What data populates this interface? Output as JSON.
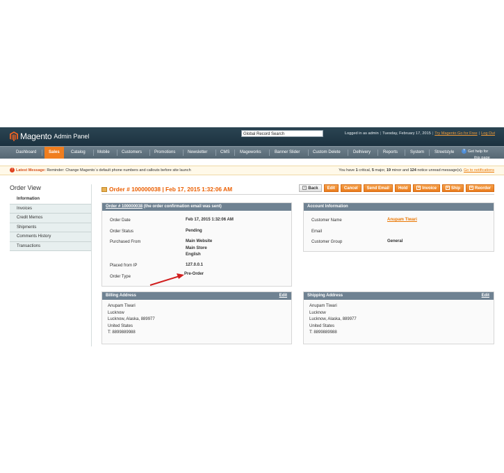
{
  "header": {
    "logo_text": "Magento",
    "logo_sub": "Admin Panel",
    "search_value": "Global Record Search",
    "logged_in": "Logged in as admin",
    "date": "Tuesday, February 17, 2015",
    "try_go": "Try Magento Go for Free",
    "logout": "Log Out"
  },
  "nav": {
    "items": [
      "Dashboard",
      "Sales",
      "Catalog",
      "Mobile",
      "Customers",
      "Promotions",
      "Newsletter",
      "CMS",
      "Mageworks",
      "Banner Slider",
      "Custom Delete",
      "Delhivery",
      "Reports",
      "System",
      "Streetstyle"
    ],
    "active": "Sales",
    "help": "Get help for this page",
    "help_line1": "Get help for",
    "help_line2": "this page"
  },
  "message": {
    "label": "Latest Message:",
    "text": "Reminder: Change Magento`s default phone numbers and callouts before site launch",
    "right_prefix": "You have",
    "critical_count": "1",
    "critical_word": "critical,",
    "major_count": "5",
    "major_word": "major,",
    "minor_count": "19",
    "minor_word": "minor and",
    "notice_count": "124",
    "notice_word": "notice unread message(s).",
    "go_link": "Go to notifications"
  },
  "sidebar": {
    "title": "Order View",
    "items": [
      "Information",
      "Invoices",
      "Credit Memos",
      "Shipments",
      "Comments History",
      "Transactions"
    ]
  },
  "page": {
    "title": "Order # 100000038 | Feb 17, 2015 1:32:06 AM",
    "buttons": [
      "Back",
      "Edit",
      "Cancel",
      "Send Email",
      "Hold",
      "Invoice",
      "Ship",
      "Reorder"
    ]
  },
  "order_box": {
    "header_link": "Order # 100000038",
    "header_note": "(the order confirmation email was sent)",
    "labels": [
      "Order Date",
      "Order Status",
      "Purchased From",
      "Placed from IP",
      "Order Type"
    ],
    "order_date": "Feb 17, 2015 1:32:06 AM",
    "status": "Pending",
    "purchased_from": [
      "Main Website",
      "Main Store",
      "English"
    ],
    "ip": "127.0.0.1",
    "order_type": "Pre-Order"
  },
  "account_box": {
    "header": "Account Information",
    "labels": [
      "Customer Name",
      "Email",
      "Customer Group"
    ],
    "customer_name": "Anupam Tiwari",
    "group": "General"
  },
  "billing": {
    "header": "Billing Address",
    "edit": "Edit",
    "lines": [
      "Anupam Tiwari",
      "Lucknow",
      "Lucknow, Alaska, 889977",
      "United States",
      "T: 8899889988"
    ]
  },
  "shipping": {
    "header": "Shipping Address",
    "edit": "Edit",
    "lines": [
      "Anupam Tiwari",
      "Lucknow",
      "Lucknow, Alaska, 889977",
      "United States",
      "T: 8899889988"
    ]
  },
  "colors": {
    "accent": "#eb5e00",
    "header_bg": "#1c3240",
    "nav_bg": "#566874",
    "box_header": "#6f8292",
    "arrow": "#d11f1f"
  }
}
